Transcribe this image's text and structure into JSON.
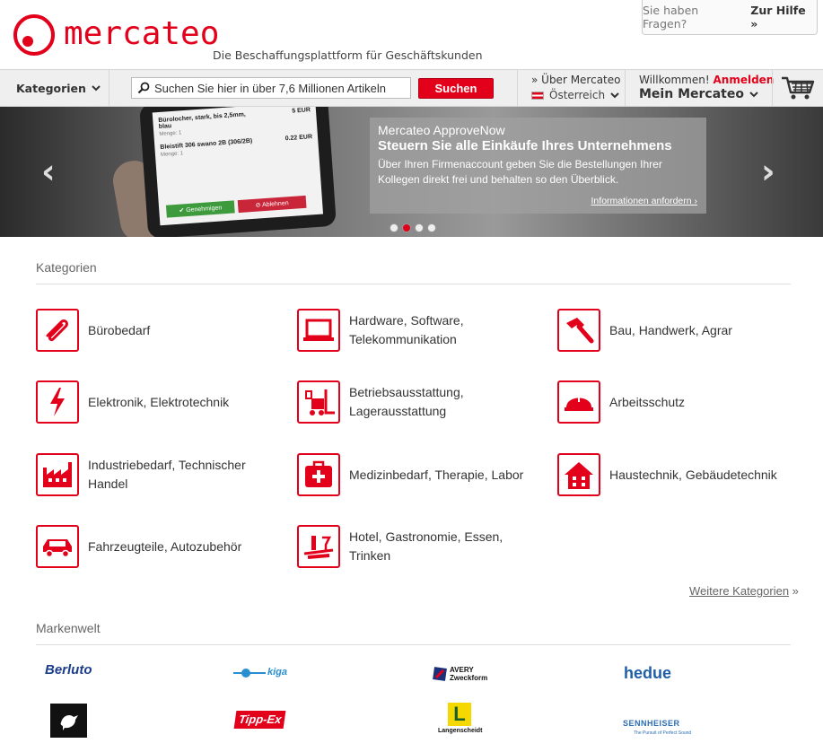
{
  "header": {
    "logo_text": "mercateo",
    "tagline": "Die Beschaffungsplattform für Geschäftskunden",
    "help_question": "Sie haben Fragen?",
    "help_link": "Zur Hilfe »"
  },
  "nav": {
    "categories_label": "Kategorien",
    "search_placeholder": "Suchen Sie hier in über 7,6 Millionen Artikeln",
    "search_button": "Suchen",
    "about_link": "» Über Mercateo",
    "country": "Österreich",
    "welcome": "Willkommen!",
    "login": "Anmelden",
    "account": "Mein Mercateo"
  },
  "banner": {
    "phone_line1": "Bürolocher, stark, bis 2,5mm, blau",
    "phone_price1": "5 EUR",
    "phone_qty1": "Menge: 1",
    "phone_line2": "Bleistift 306 swano 2B (306/2B)",
    "phone_price2": "0.22 EUR",
    "phone_qty2": "Menge: 1",
    "phone_approve": "✔ Genehmigen",
    "phone_reject": "⊘ Ablehnen",
    "kicker": "Mercateo ApproveNow",
    "headline": "Steuern Sie alle Einkäufe Ihres Unternehmens",
    "text": "Über Ihren Firmenaccount geben Sie die Bestellungen Ihrer Kollegen direkt frei und behalten so den Überblick.",
    "cta": "Informationen anfordern ›",
    "prev_arrow": "‹",
    "next_arrow": "›",
    "slide_count": 4,
    "active_slide": 2
  },
  "categories": {
    "title": "Kategorien",
    "items": [
      {
        "label": "Bürobedarf",
        "icon": "paperclip-icon"
      },
      {
        "label": "Hardware, Software, Telekommunikation",
        "icon": "laptop-icon"
      },
      {
        "label": "Bau, Handwerk, Agrar",
        "icon": "hammer-icon"
      },
      {
        "label": "Elektronik, Elektrotechnik",
        "icon": "lightning-icon"
      },
      {
        "label": "Betriebsausstattung, Lagerausstattung",
        "icon": "forklift-icon"
      },
      {
        "label": "Arbeitsschutz",
        "icon": "helmet-icon"
      },
      {
        "label": "Industriebedarf, Technischer Handel",
        "icon": "factory-icon"
      },
      {
        "label": "Medizinbedarf, Therapie, Labor",
        "icon": "first-aid-icon"
      },
      {
        "label": "Haustechnik, Gebäudetechnik",
        "icon": "house-icon"
      },
      {
        "label": "Fahrzeugteile, Autozubehör",
        "icon": "car-icon"
      },
      {
        "label": "Hotel, Gastronomie, Essen, Trinken",
        "icon": "waiter-tray-icon"
      }
    ],
    "more_link": "Weitere Kategorien",
    "more_arrow": "»"
  },
  "brands": {
    "title": "Markenwelt",
    "items": [
      {
        "name": "Berluto"
      },
      {
        "name": "kiga"
      },
      {
        "name": "AVERY Zweckform"
      },
      {
        "name": "hedue"
      },
      {
        "name": "bird-logo"
      },
      {
        "name": "Tipp-Ex"
      },
      {
        "name": "Langenscheidt",
        "mark": "L"
      },
      {
        "name": "SENNHEISER",
        "tagline": "The Pursuit of Perfect Sound"
      }
    ]
  },
  "colors": {
    "brand_red": "#e3001b",
    "nav_bg": "#efefef"
  }
}
